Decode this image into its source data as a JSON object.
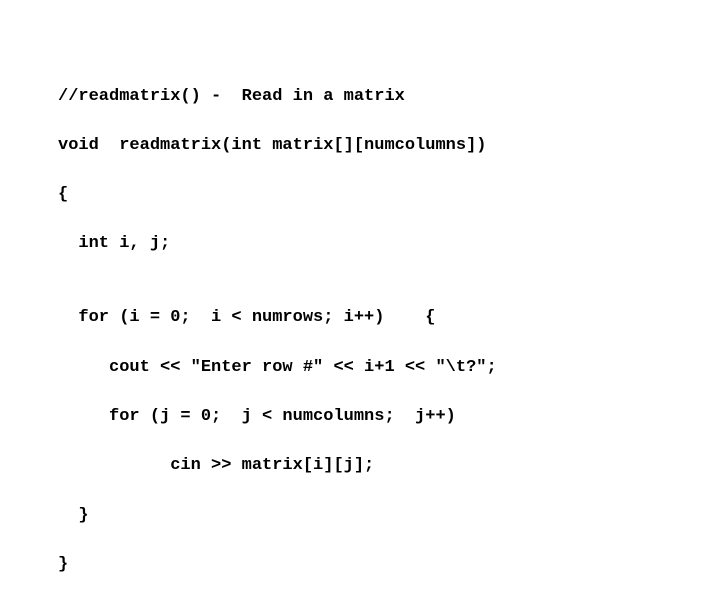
{
  "code": {
    "lines": [
      "//readmatrix() -  Read in a matrix",
      "void  readmatrix(int matrix[][numcolumns])",
      "{",
      "  int i, j;",
      "",
      "  for (i = 0;  i < numrows; i++)    {",
      "     cout << \"Enter row #\" << i+1 << \"\\t?\";",
      "     for (j = 0;  j < numcolumns;  j++)",
      "           cin >> matrix[i][j];",
      "  }",
      "}"
    ]
  }
}
